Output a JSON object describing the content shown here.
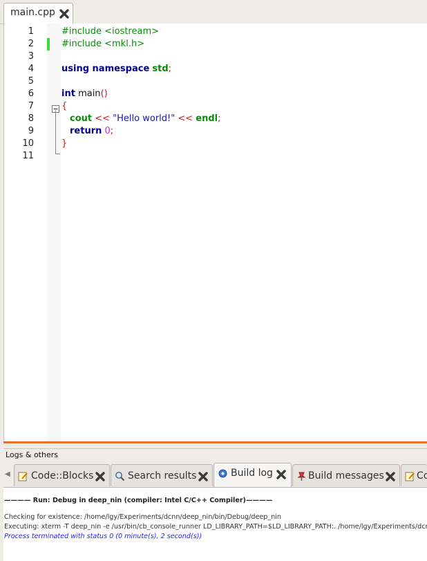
{
  "editor": {
    "tab_label": "main.cpp",
    "lines": [
      {
        "num": "1"
      },
      {
        "num": "2"
      },
      {
        "num": "3"
      },
      {
        "num": "4"
      },
      {
        "num": "5"
      },
      {
        "num": "6"
      },
      {
        "num": "7"
      },
      {
        "num": "8"
      },
      {
        "num": "9"
      },
      {
        "num": "10"
      },
      {
        "num": "11"
      }
    ],
    "code": {
      "l1": "#include <iostream>",
      "l2": "#include <mkl.h>",
      "l4_kw": "using namespace",
      "l4_ns": "std",
      "l4_end": ";",
      "l6_kw": "int",
      "l6_name": " main",
      "l6_paren": "()",
      "l7": "{",
      "l8_kw": "cout",
      "l8_op1": " << ",
      "l8_str": "\"Hello world!\"",
      "l8_op2": " << ",
      "l8_endl": "endl",
      "l8_end": ";",
      "l9_kw": "return",
      "l9_num": " 0",
      "l9_end": ";",
      "l10": "}"
    },
    "accent_color": "#e8702a",
    "modified_marker_color": "#3ddc3d"
  },
  "panel": {
    "title": "Logs & others",
    "tabs": [
      {
        "label": "Code::Blocks"
      },
      {
        "label": "Search results"
      },
      {
        "label": "Build log"
      },
      {
        "label": "Build messages"
      },
      {
        "label": "Co"
      }
    ],
    "active_tab": "Build log",
    "log": {
      "header": "———— Run: Debug in deep_nin (compiler: Intel C/C++ Compiler)————",
      "line1": "Checking for existence: /home/lgy/Experiments/dcnn/deep_nin/bin/Debug/deep_nin",
      "line2": "Executing: xterm -T deep_nin -e /usr/bin/cb_console_runner LD_LIBRARY_PATH=$LD_LIBRARY_PATH:. /home/lgy/Experiments/dcnn",
      "line3": "Process terminated with status 0 (0 minute(s), 2 second(s))"
    }
  }
}
